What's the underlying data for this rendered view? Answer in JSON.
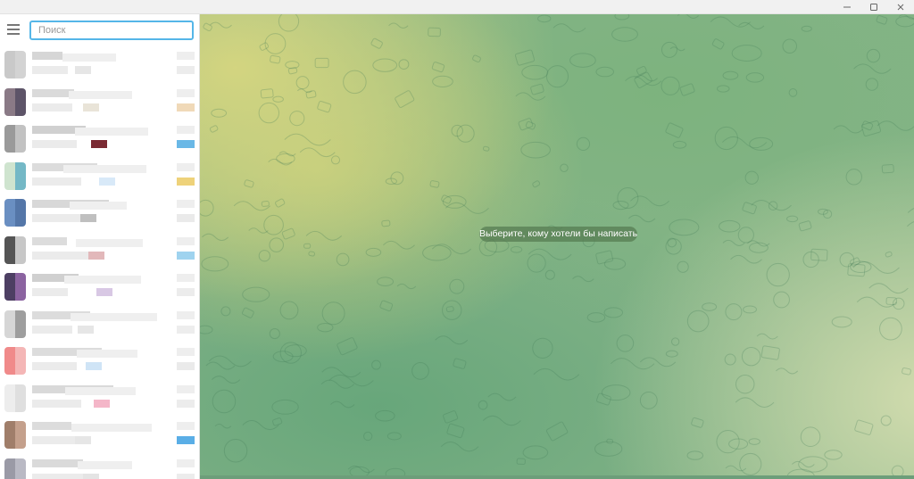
{
  "window": {
    "controls": [
      {
        "name": "minimize-icon"
      },
      {
        "name": "maximize-icon"
      },
      {
        "name": "close-icon"
      }
    ]
  },
  "sidebar": {
    "search": {
      "placeholder": "Поиск",
      "value": ""
    },
    "chats": [
      {
        "avatar": [
          "#c9c9c9",
          "#d3d3d3"
        ],
        "blocks": [
          {
            "c": "#d6d6d6"
          },
          {
            "c": "#e6e6e6"
          },
          {
            "c": "#ececec"
          }
        ]
      },
      {
        "avatar": [
          "#8a7a86",
          "#5d5468"
        ],
        "blocks": [
          {
            "c": "#dadada"
          },
          {
            "c": "#e9e4d8"
          },
          {
            "c": "#f0d9b8"
          }
        ]
      },
      {
        "avatar": [
          "#9a9a9a",
          "#c2c2c2"
        ],
        "blocks": [
          {
            "c": "#d0d0d0"
          },
          {
            "c": "#7a2a33"
          },
          {
            "c": "#6ab8e6"
          }
        ]
      },
      {
        "avatar": [
          "#cfe4cf",
          "#74b8c6"
        ],
        "blocks": [
          {
            "c": "#dcdcdc"
          },
          {
            "c": "#d8e9f8"
          },
          {
            "c": "#eed27a"
          }
        ]
      },
      {
        "avatar": [
          "#6a8fc2",
          "#5476a8"
        ],
        "blocks": [
          {
            "c": "#d8d8d8"
          },
          {
            "c": "#bfbfbf"
          },
          {
            "c": "#eaeaea"
          }
        ]
      },
      {
        "avatar": [
          "#555555",
          "#c7c7c7"
        ],
        "blocks": [
          {
            "c": "#dcdcdc"
          },
          {
            "c": "#e2b8ba"
          },
          {
            "c": "#9fd3ef"
          }
        ]
      },
      {
        "avatar": [
          "#4d3f63",
          "#8b63a0"
        ],
        "blocks": [
          {
            "c": "#d0d0d0"
          },
          {
            "c": "#d8c8e4"
          },
          {
            "c": "#ececec"
          }
        ]
      },
      {
        "avatar": [
          "#d6d6d6",
          "#9e9e9e"
        ],
        "blocks": [
          {
            "c": "#dcdcdc"
          },
          {
            "c": "#e6e6e6"
          },
          {
            "c": "#ededed"
          }
        ]
      },
      {
        "avatar": [
          "#f08a8a",
          "#f4b6b6"
        ],
        "blocks": [
          {
            "c": "#dcdcdc"
          },
          {
            "c": "#cfe4f6"
          },
          {
            "c": "#eaeaea"
          }
        ]
      },
      {
        "avatar": [
          "#ededed",
          "#dfdfdf"
        ],
        "blocks": [
          {
            "c": "#d9d9d9"
          },
          {
            "c": "#f4b6c8"
          },
          {
            "c": "#ececec"
          }
        ]
      },
      {
        "avatar": [
          "#a07e6a",
          "#c4a08c"
        ],
        "blocks": [
          {
            "c": "#dcdcdc"
          },
          {
            "c": "#e6e6e6"
          },
          {
            "c": "#5aaee6"
          }
        ]
      },
      {
        "avatar": [
          "#9a9aa6",
          "#b9b9c4"
        ],
        "blocks": [
          {
            "c": "#dadada"
          },
          {
            "c": "#e4e4e4"
          },
          {
            "c": "#ececec"
          }
        ]
      }
    ]
  },
  "main": {
    "empty_state": "Выберите, кому хотели бы написать",
    "colors": {
      "pill": "#557a50",
      "pattern": "#3f7a55"
    }
  }
}
